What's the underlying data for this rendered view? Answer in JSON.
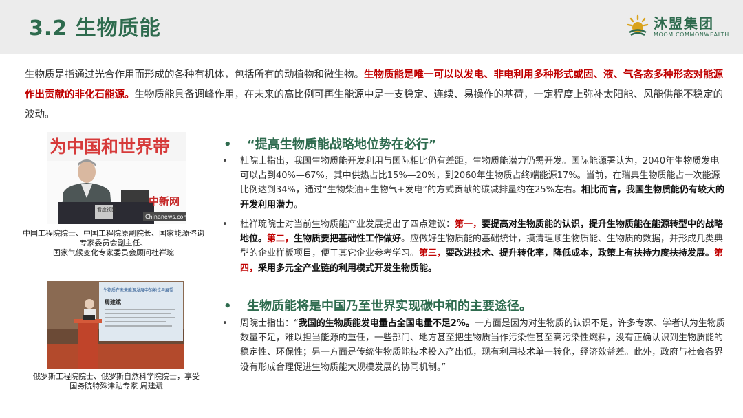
{
  "header": {
    "title": "3.2 生物质能",
    "logo_cn": "沐盟集团",
    "logo_en": "MOOM COMMONWEALTH"
  },
  "intro": {
    "part1": "生物质是指通过光合作用而形成的各种有机体，包括所有的动植物和微生物。",
    "highlight": "生物质能是唯一可以以发电、非电利用多种形式或固、液、气各态多种形态对能源作出贡献的非化石能源。",
    "part2": "生物质能具备调峰作用，在未来的高比例可再生能源中是一支稳定、连续、易操作的基荷，一定程度上弥补太阳能、风能供能不稳定的波动。"
  },
  "photos": [
    {
      "banner": "为中国和世界带",
      "sign_text": "中新网",
      "sign_url": "Chinanews.com",
      "podium_label": "看度视面",
      "caption_lines": [
        "中国工程院院士、中国工程院原副院长、国家能源咨询",
        "专家委员会副主任、",
        "国家气候变化专家委员会顾问杜祥琬"
      ]
    },
    {
      "screen_title": "生物质在未来能源发展中的地位与展望",
      "screen_name": "周建斌",
      "caption_lines": [
        "俄罗斯工程院院士、俄罗斯自然科学院院士，享受",
        "国务院特殊津贴专家 周建斌"
      ]
    }
  ],
  "sections": [
    {
      "bullet": "•",
      "heading": "“提高生物质能战略地位势在必行”",
      "paragraphs": [
        {
          "bullet": "•",
          "t1": "杜院士指出，我国生物质能开发利用与国际相比仍有差距，生物质能潜力仍需开发。国际能源署认为，2040年生物质发电可以占到40%—67%，其中供热占比15%—20%，到2060年生物质占终端能源17%。当前，在瑞典生物质能占一次能源比例达到34%，通过“生物柴油+生物气+发电”的方式贡献的碳减排量约在25%左右。",
          "b1": "相比而言，我国生物质能仍有较大的开发利用潜力。"
        },
        {
          "bullet": "•",
          "t1": "杜祥琬院士对当前生物质能产业发展提出了四点建议：",
          "r1": "第一，",
          "b1": "要提高对生物质能的认识，提升生物质能在能源转型中的战略地位。",
          "r2": "第二，",
          "b2": "生物质要把基础性工作做好",
          "t2": "。应做好生物质能的基础统计，摸清理顺生物质能、生物质的数据，并形成几类典型的企业样板项目，便于其它企业参考学习。",
          "r3": "第三，",
          "b3": "要改进技术、提升转化率，降低成本，政策上有扶持力度扶持发展。",
          "r4": "第四，",
          "b4": "采用多元全产业链的利用模式开发生物质能。"
        }
      ]
    },
    {
      "bullet": "•",
      "heading": "生物质能将是中国乃至世界实现碳中和的主要途径。",
      "paragraphs": [
        {
          "bullet": "•",
          "t1": "周院士指出：“",
          "b1": "我国的生物质能发电量占全国电量不足2%。",
          "t2": "一方面是因为对生物质的认识不足，许多专家、学者认为生物质数量不足，难以担当能源的重任，一些部门、地方甚至把生物质当作污染性甚至高污染性燃料，没有正确认识到生物质能的稳定性、环保性；另一方面是传统生物质能技术投入产出低，现有利用技术单一转化，经济效益差。此外，政府与社会各界没有形成合理促进生物质能大规模发展的协同机制。”"
        }
      ]
    }
  ],
  "colors": {
    "brand_green": "#2e6b4e",
    "highlight_red": "#c00000",
    "header_bg": "#ececec",
    "logo_gold": "#d9a21b"
  }
}
